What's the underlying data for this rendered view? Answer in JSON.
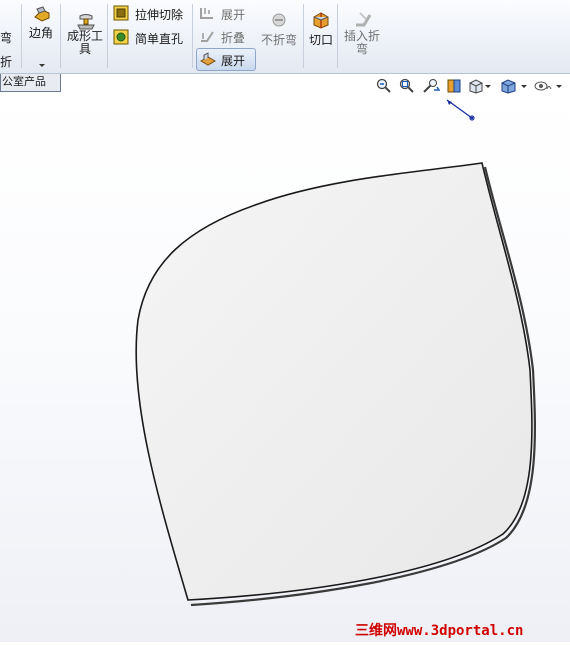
{
  "ribbon": {
    "left_cut_top": "弯",
    "left_cut_bottom": "折",
    "edge_flange_label": "边角",
    "forming_tool_label": "成形工具",
    "extruded_cut_label": "拉伸切除",
    "simple_hole_label": "简单直孔",
    "unfold_label": "展开",
    "fold_label": "折叠",
    "flatten_label": "展开",
    "no_bends_label": "不折弯",
    "rip_label": "切口",
    "insert_bends_label": "插入折弯"
  },
  "tabs": {
    "active_tab_label": "公室产品"
  },
  "watermark": {
    "text": "三维网www.3dportal.cn"
  },
  "colors": {
    "ribbon_bg": "#eef2f8",
    "active_button": "#cad9ee",
    "part_face": "#efefef",
    "part_edge": "#1a1a1a",
    "watermark": "#d10000",
    "triad_arrow": "#1a2fa0"
  },
  "icons": {
    "headsup": [
      "zoom-to-fit-icon",
      "zoom-area-icon",
      "previous-view-icon",
      "section-view-icon",
      "view-orientation-icon",
      "display-style-icon",
      "hide-show-items-icon"
    ]
  }
}
